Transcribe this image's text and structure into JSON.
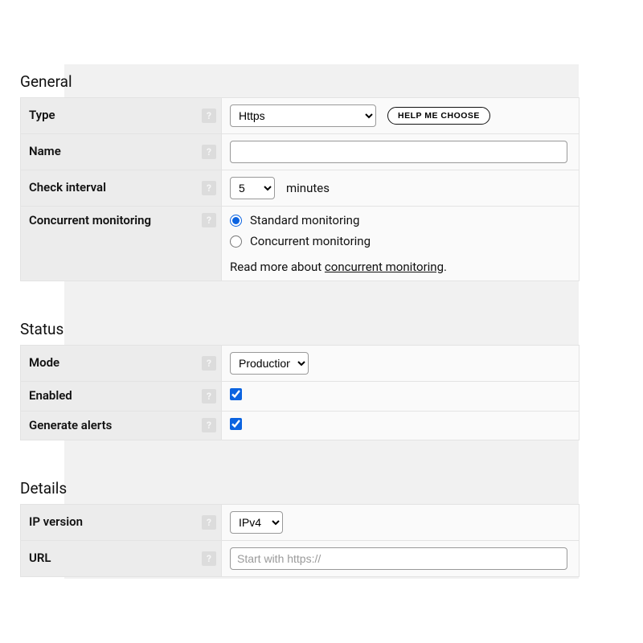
{
  "general": {
    "title": "General",
    "type": {
      "label": "Type",
      "value": "Https",
      "help_button": "HELP ME CHOOSE"
    },
    "name": {
      "label": "Name",
      "value": ""
    },
    "check_interval": {
      "label": "Check interval",
      "value": "5",
      "unit_label": "minutes"
    },
    "concurrent": {
      "label": "Concurrent monitoring",
      "option_standard": "Standard monitoring",
      "option_concurrent": "Concurrent monitoring",
      "selected": "standard",
      "readmore_prefix": "Read more about ",
      "readmore_link": "concurrent monitoring",
      "readmore_suffix": "."
    }
  },
  "status": {
    "title": "Status",
    "mode": {
      "label": "Mode",
      "value": "Production"
    },
    "enabled": {
      "label": "Enabled",
      "checked": true
    },
    "generate_alerts": {
      "label": "Generate alerts",
      "checked": true
    }
  },
  "details": {
    "title": "Details",
    "ip_version": {
      "label": "IP version",
      "value": "IPv4"
    },
    "url": {
      "label": "URL",
      "value": "",
      "placeholder": "Start with https://"
    }
  },
  "help_icon_char": "?"
}
